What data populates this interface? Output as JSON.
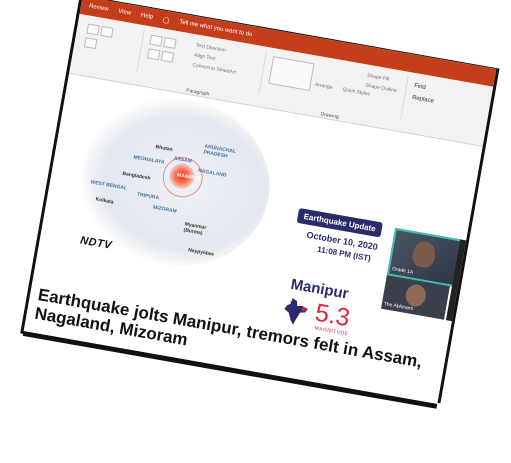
{
  "ribbon": {
    "tabs": [
      "Review",
      "View",
      "Help"
    ],
    "tell_me": "Tell me what you want to do",
    "groups": {
      "paragraph": "Paragraph",
      "drawing": "Drawing",
      "editing": {
        "find": "Find",
        "replace": "Replace"
      },
      "text_direction": "Text Direction",
      "align_text": "Align Text",
      "convert_smartart": "Convert to SmartArt",
      "arrange": "Arrange",
      "quick_styles": "Quick Styles",
      "shape_fill": "Shape Fill",
      "shape_outline": "Shape Outline"
    }
  },
  "slide": {
    "map_labels": {
      "bhutan": "Bhutan",
      "arunachal": "ARUNACHAL PRADESH",
      "meghalaya": "MEGHALAYA",
      "assam": "ASSAM",
      "nagaland": "NAGALAND",
      "manipur": "MANIPUR",
      "bangladesh": "Bangladesh",
      "west_bengal": "WEST BENGAL",
      "tripura": "TRIPURA",
      "mizoram": "MIZORAM",
      "kolkata": "Kolkata",
      "myanmar": "Myanmar (Burma)",
      "naypyidaw": "Naypyidaw"
    },
    "ndtv_logo": "NDTV",
    "update_badge": "Earthquake Update",
    "update_date": "October 10, 2020",
    "update_time": "11:08 PM (IST)",
    "state": "Manipur",
    "magnitude": "5.3",
    "magnitude_label": "MAGNITUDE",
    "headline": "Earthquake jolts Manipur, tremors felt in Assam, Nagaland, Mizoram"
  },
  "video": {
    "participant1": "Grade 1A",
    "participant2": "The Abhirami"
  },
  "colors": {
    "ribbon": "#c43e1c",
    "navy": "#2b2a6b",
    "accent_red": "#e0273b",
    "video_border": "#3fbfb0"
  }
}
